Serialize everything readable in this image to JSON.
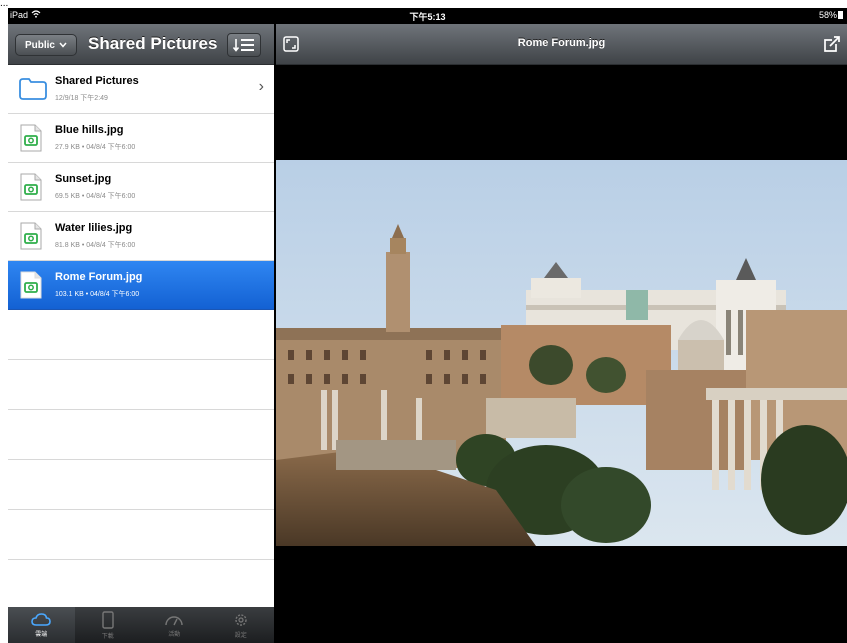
{
  "caption": "...",
  "status": {
    "device": "iPad",
    "time": "下午5:13",
    "battery": "58%"
  },
  "left": {
    "public_label": "Public",
    "title": "Shared Pictures",
    "rows": [
      {
        "name": "Shared Pictures",
        "meta": "12/9/18 下午2:49"
      },
      {
        "name": "Blue hills.jpg",
        "meta": "27.9 KB • 04/8/4 下午6:00"
      },
      {
        "name": "Sunset.jpg",
        "meta": "69.5 KB • 04/8/4 下午6:00"
      },
      {
        "name": "Water lilies.jpg",
        "meta": "81.8 KB • 04/8/4 下午6:00"
      },
      {
        "name": "Rome Forum.jpg",
        "meta": "103.1 KB • 04/8/4 下午6:00"
      }
    ],
    "tabs": [
      "雲端",
      "下載",
      "活動",
      "設定"
    ]
  },
  "viewer": {
    "title": "Rome Forum.jpg"
  },
  "colors": {
    "selected": "#1f6fe0",
    "toolbar": "#55595e",
    "file_icon_green": "#2fae4a",
    "folder_blue": "#3a8fe0"
  },
  "icons": {
    "folder": "folder-icon",
    "image_file": "image-file-icon",
    "sort": "sort-list-icon",
    "fullscreen": "fullscreen-icon",
    "share": "share-icon",
    "tabs": [
      "cloud-icon",
      "tablet-icon",
      "gauge-icon",
      "gear-icon"
    ]
  }
}
